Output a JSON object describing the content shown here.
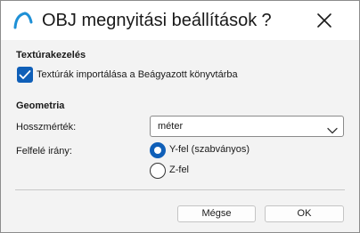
{
  "window": {
    "title": "OBJ megnyitási beállítások",
    "help_label": "?",
    "icons": {
      "app": "arc-app-icon",
      "close": "close-icon"
    }
  },
  "textures": {
    "section_title": "Textúrakezelés",
    "import_checkbox": {
      "label": "Textúrák importálása a Beágyazott könyvtárba",
      "checked": true
    }
  },
  "geometry": {
    "section_title": "Geometria",
    "length_unit": {
      "label": "Hosszmérték:",
      "value": "méter"
    },
    "up_direction": {
      "label": "Felfelé irány:",
      "options": [
        {
          "label": "Y-fel (szabványos)",
          "selected": true
        },
        {
          "label": "Z-fel",
          "selected": false
        }
      ]
    }
  },
  "buttons": {
    "cancel": "Mégse",
    "ok": "OK"
  },
  "colors": {
    "accent": "#0f5fb8",
    "dialog_background": "#f3f3f3",
    "titlebar": "#ffffff"
  }
}
